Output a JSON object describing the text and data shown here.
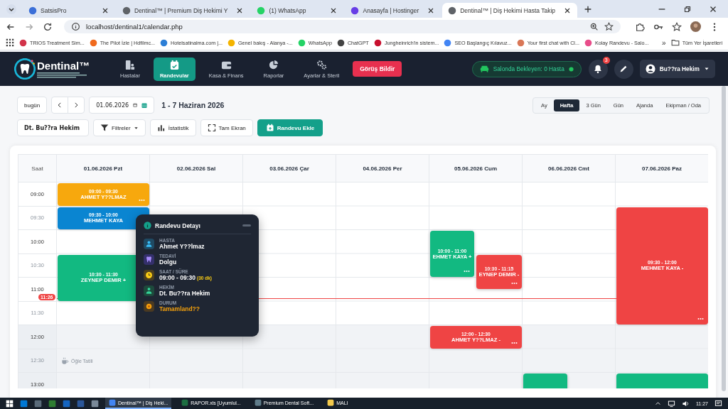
{
  "browser": {
    "tabs": [
      {
        "title": "SatsisPro",
        "selected": false,
        "color": "#3b6fd8"
      },
      {
        "title": "Dentinal™ | Premium Diş Hekimi Y",
        "selected": false,
        "color": "#5f6368"
      },
      {
        "title": "(1) WhatsApp",
        "selected": false,
        "color": "#25d366"
      },
      {
        "title": "Anasayfa | Hostinger",
        "selected": false,
        "color": "#673de6"
      },
      {
        "title": "Dentinal™ | Diş Hekimi Hasta Takip",
        "selected": true,
        "color": "#5f6368"
      }
    ],
    "address": "localhost/dentinal1/calendar.php",
    "bookmarks": [
      {
        "title": "TRIOS Treatment Sim...",
        "color": "#d2334a"
      },
      {
        "title": "The Pilot İzle | Hdfilmc...",
        "color": "#f06a1d"
      },
      {
        "title": "Hotelsatinalma.com |...",
        "color": "#2d7fd6"
      },
      {
        "title": "Genel bakış - Alanya -...",
        "color": "#f4b400"
      },
      {
        "title": "WhatsApp",
        "color": "#25d366"
      },
      {
        "title": "ChatGPT",
        "color": "#444444"
      },
      {
        "title": "Jungheinrich'in sistem...",
        "color": "#c8102e"
      },
      {
        "title": "SEO Başlangıç Kılavuz...",
        "color": "#4285f4"
      },
      {
        "title": "Your first chat with Cl...",
        "color": "#d97757"
      },
      {
        "title": "Kolay Randevu - Salo...",
        "color": "#e84d8a"
      }
    ],
    "bookmarks_more": "»",
    "all_bookmarks": "Tüm Yer İşaretleri"
  },
  "app": {
    "logo": "Dentinal™",
    "nav": [
      {
        "label": "Hastalar",
        "selected": false
      },
      {
        "label": "Randevular",
        "selected": true
      },
      {
        "label": "Kasa & Finans",
        "selected": false
      },
      {
        "label": "Raporlar",
        "selected": false
      },
      {
        "label": "Ayarlar & Steril",
        "selected": false
      }
    ],
    "feedback_button": "Görüş Bildir",
    "waiting": "Salonda Bekleyen: 0 Hasta",
    "notifications": "3",
    "user": "Bu??ra Hekim"
  },
  "toolbar": {
    "today": "bugün",
    "date": "01.06.2026",
    "range_title": "1 - 7 Haziran 2026",
    "views": [
      {
        "label": "Ay",
        "selected": false
      },
      {
        "label": "Hafta",
        "selected": true
      },
      {
        "label": "3 Gün",
        "selected": false
      },
      {
        "label": "Gün",
        "selected": false
      },
      {
        "label": "Ajanda",
        "selected": false
      },
      {
        "label": "Ekipman / Oda",
        "selected": false
      }
    ],
    "doctor": "Dt. Bu??ra Hekim",
    "filters": "Filtreler",
    "stats": "İstatistik",
    "fullscreen": "Tam Ekran",
    "add": "Randevu Ekle"
  },
  "calendar": {
    "time_header": "Saat",
    "now": "11:26",
    "times": [
      {
        "time": "09:00",
        "major": true,
        "shaded": false
      },
      {
        "time": "09:30",
        "major": false,
        "shaded": false
      },
      {
        "time": "10:00",
        "major": true,
        "shaded": false
      },
      {
        "time": "10:30",
        "major": false,
        "shaded": false
      },
      {
        "time": "11:00",
        "major": true,
        "shaded": false
      },
      {
        "time": "11:30",
        "major": false,
        "shaded": false
      },
      {
        "time": "12:00",
        "major": true,
        "shaded": true
      },
      {
        "time": "12:30",
        "major": false,
        "shaded": true,
        "break_label": "Öğle Tatili"
      },
      {
        "time": "13:00",
        "major": true,
        "shaded": true
      }
    ],
    "days": [
      {
        "label": "01.06.2026 Pzt",
        "events": [
          {
            "kind": "timed",
            "time": "09:00 - 09:30",
            "name": "AHMET Y??LMAZ",
            "color": "#f7a80d",
            "menu": true
          },
          {
            "kind": "timed",
            "time": "09:30 - 10:00",
            "name": "MEHMET KAYA",
            "color": "#0a85d1"
          },
          {
            "kind": "timed",
            "time": "10:30 - 11:30",
            "name": "ZEYNEP DEMIR +",
            "color": "#12b981"
          }
        ]
      },
      {
        "label": "02.06.2026 Sal"
      },
      {
        "label": "03.06.2026 Çar"
      },
      {
        "label": "04.06.2026 Per"
      },
      {
        "label": "05.06.2026 Cum",
        "events": [
          {
            "kind": "timed",
            "time": "10:00 - 11:00",
            "name": "EHMET KAYA +",
            "color": "#12b981",
            "menu": true,
            "narrow": true
          },
          {
            "kind": "timed",
            "time": "10:30 - 11:15",
            "name": "EYNEP DEMIR -",
            "color": "#ef4444",
            "menu": true,
            "shifted": true
          },
          {
            "kind": "timed",
            "time": "12:00 - 12:30",
            "name": "AHMET Y??LMAZ -",
            "color": "#ef4444",
            "menu": true
          }
        ]
      },
      {
        "label": "06.06.2026 Cmt",
        "events": [
          {
            "kind": "partial",
            "color": "#12b981",
            "narrow": true
          }
        ]
      },
      {
        "label": "07.06.2026 Paz",
        "events": [
          {
            "kind": "timed",
            "time": "09:30 - 12:00",
            "name": "MEHMET KAYA -",
            "color": "#ef4444",
            "menu": true
          },
          {
            "kind": "partial",
            "color": "#12b981"
          }
        ]
      }
    ]
  },
  "popup": {
    "title": "Randevu Detayı",
    "fields": [
      {
        "kind": "patient",
        "label": "HASTA",
        "value": "Ahmet Y??lmaz",
        "highlight": false
      },
      {
        "kind": "treatment",
        "label": "TEDAVİ",
        "value": "Dolgu",
        "highlight": false
      },
      {
        "kind": "time",
        "label": "SAAT / SÜRE",
        "value": "09:00 - 09:30",
        "note": "(30 dk)",
        "highlight": false
      },
      {
        "kind": "doctor",
        "label": "HEKİM",
        "value": "Dt. Bu??ra Hekim",
        "highlight": false
      },
      {
        "kind": "status",
        "label": "DURUM",
        "value": "Tamamland??",
        "highlight": true
      }
    ]
  },
  "taskbar": {
    "pinned": [
      {
        "color": "#0078d4"
      },
      {
        "color": "#5a6b7a"
      },
      {
        "color": "#2e7d32"
      },
      {
        "color": "#1565c0"
      },
      {
        "color": "#2b579a"
      },
      {
        "color": "#7a8a99"
      }
    ],
    "windows": [
      {
        "title": "Dentinal™ | Diş Heki...",
        "selected": true,
        "color": "#4285f4"
      },
      {
        "title": "RAPOR.xls [Uyumlul...",
        "selected": false,
        "color": "#1d6f42"
      },
      {
        "title": "Premium Dental Soft...",
        "selected": false,
        "color": "#607d8b"
      },
      {
        "title": "MALI",
        "selected": false,
        "color": "#f2c94c"
      }
    ],
    "clock": "11:27"
  }
}
